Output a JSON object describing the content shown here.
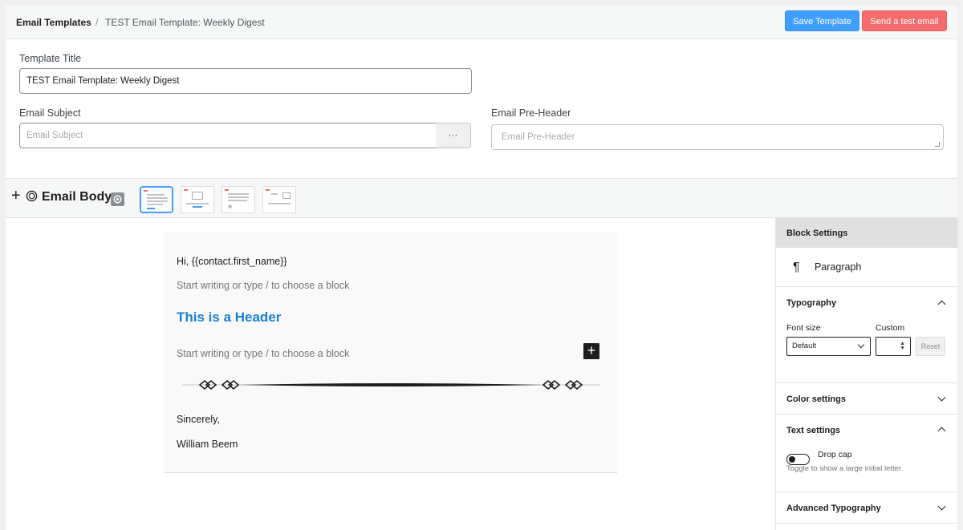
{
  "header": {
    "breadcrumb_root": "Email Templates",
    "separator": "/",
    "current_template": "TEST Email Template: Weekly Digest",
    "save_label": "Save Template",
    "test_label": "Send a test email"
  },
  "form": {
    "title_label": "Template Title",
    "title_value": "TEST Email Template: Weekly Digest",
    "subject_label": "Email Subject",
    "subject_placeholder": "Email Subject",
    "subject_more": "···",
    "preheader_label": "Email Pre-Header",
    "preheader_placeholder": "Email Pre-Header"
  },
  "toolbar": {
    "add_icon": "+",
    "title": "Email Body"
  },
  "email": {
    "greeting": "Hi, {{contact.first_name}}",
    "placeholder_1": "Start writing or type / to choose a block",
    "heading": "This is a Header",
    "placeholder_2": "Start writing or type / to choose a block",
    "add_block": "+",
    "closing": "Sincerely,",
    "signature": "William Beem"
  },
  "sidebar": {
    "title": "Block Settings",
    "block_icon": "¶",
    "block_name": "Paragraph",
    "typography": "Typography",
    "font_size_label": "Font size",
    "custom_label": "Custom",
    "font_size_value": "Default",
    "reset_label": "Reset",
    "color_settings": "Color settings",
    "text_settings": "Text settings",
    "drop_cap_label": "Drop cap",
    "drop_cap_help": "Toggle to show a large initial letter.",
    "advanced_typography": "Advanced Typography"
  },
  "colors": {
    "primary": "#409eff",
    "danger": "#f56c6c",
    "heading": "#1a7fd6"
  }
}
